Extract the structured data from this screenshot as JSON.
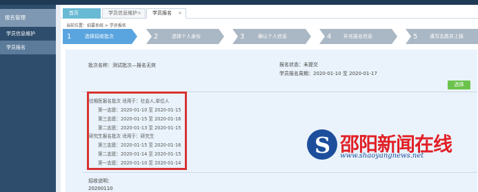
{
  "sidebar": {
    "title": "报名管理",
    "items": [
      {
        "label": "学员信息维护"
      },
      {
        "label": "学员报名"
      }
    ]
  },
  "tabs": [
    {
      "label": "首页"
    },
    {
      "label": "学员信息维护",
      "close": "×"
    },
    {
      "label": "学员报名",
      "close": "×"
    }
  ],
  "breadcrumb": "当前位置：招要系统 > 学员报名",
  "steps": [
    {
      "num": "1",
      "label": "选择招收批次"
    },
    {
      "num": "2",
      "label": "选择个人身份"
    },
    {
      "num": "3",
      "label": "确认个人信息"
    },
    {
      "num": "4",
      "label": "补充报名信息"
    },
    {
      "num": "5",
      "label": "填写志愿并上报"
    }
  ],
  "batch_info": {
    "name": "批次名称：测试批次—报名无效",
    "status": "报名状态：未提交",
    "period": "学员报名周期：2020-01-10 至 2020-01-17",
    "select_label": "选择"
  },
  "batches": [
    {
      "header": "往期医报名批次 适用于：社会人,单位人",
      "rows": [
        "第一志愿：2020-01-10 至 2020-01-15",
        "第三志愿：2020-01-15 至 2020-01-16",
        "第二志愿：2020-01-13 至 2020-01-15"
      ]
    },
    {
      "header": "研究生报名批次 适用于：研究生",
      "rows": [
        "第三志愿：2020-01-15 至 2020-01-16",
        "第二志愿：2020-01-14 至 2020-01-15",
        "第一志愿：2020-01-10 至 2020-01-14"
      ]
    }
  ],
  "remark": {
    "label": "招收说明：",
    "value": "20200110"
  },
  "watermark": {
    "cn": "邵阳新闻在线",
    "url": "www.shaoyangnews.net"
  },
  "colors": {
    "sidebar": "#2e4d6c",
    "step_bg": "#aab7c4",
    "step_active": "#5aa5e0",
    "button": "#6cc34c",
    "highlight_box": "#d83030"
  }
}
